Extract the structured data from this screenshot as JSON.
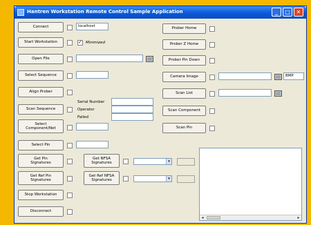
{
  "window": {
    "title": "Hantren Workstation Remote Control Sample Application",
    "minimize_glyph": "_",
    "maximize_glyph": "□",
    "close_glyph": "✕"
  },
  "left": {
    "connect_label": "Connect",
    "connect_host": "localhost",
    "start_workstation_label": "Start Workstation",
    "minimized_label": "Minimized",
    "minimized_checked": true,
    "open_file_label": "Open File",
    "open_file_value": "",
    "select_sequence_label": "Select Sequence",
    "select_sequence_value": "",
    "align_prober_label": "Align Prober",
    "scan_sequence_label": "Scan Sequence",
    "serial_number_label": "Serial Number",
    "operator_label": "Operator",
    "failed_label": "Failed",
    "serial_number_value": "",
    "operator_value": "",
    "failed_value": "",
    "select_component_label_1": "Select",
    "select_component_label_2": "Component/Net",
    "select_component_value": "",
    "select_pin_label": "Select Pin",
    "select_pin_value": "",
    "get_pin_signatures_label_1": "Get Pin",
    "get_pin_signatures_label_2": "Signatures",
    "get_ref_pin_signatures_label_1": "Get Ref Pin",
    "get_ref_pin_signatures_label_2": "Signatures",
    "stop_workstation_label": "Stop Workstation",
    "disconnect_label": "Disconnect"
  },
  "middle": {
    "get_nfsa_signatures_label_1": "Get NFSA",
    "get_nfsa_signatures_label_2": "Signatures",
    "get_ref_nfsa_signatures_label_1": "Get Ref NFSA",
    "get_ref_nfsa_signatures_label_2": "Signatures",
    "nfsa_combo_value": "",
    "ref_nfsa_combo_value": ""
  },
  "right": {
    "prober_home_label": "Prober Home",
    "prober_z_home_label": "Prober Z Home",
    "prober_pin_down_label": "Prober Pin Down",
    "camera_image_label": "Camera Image",
    "camera_image_path": "",
    "camera_image_format": "BMP",
    "scan_list_label": "Scan List",
    "scan_list_path": "",
    "scan_component_label": "Scan Component",
    "scan_pin_label": "Scan Pin",
    "output_text": ""
  },
  "icons": {
    "folder": "folder-open-icon",
    "dropdown": "chevron-down-icon",
    "app": "app-icon"
  },
  "colors": {
    "background": "#f5b800",
    "window_face": "#ece9d8",
    "titlebar": "#0a5ad8",
    "close_button": "#d9452c"
  }
}
